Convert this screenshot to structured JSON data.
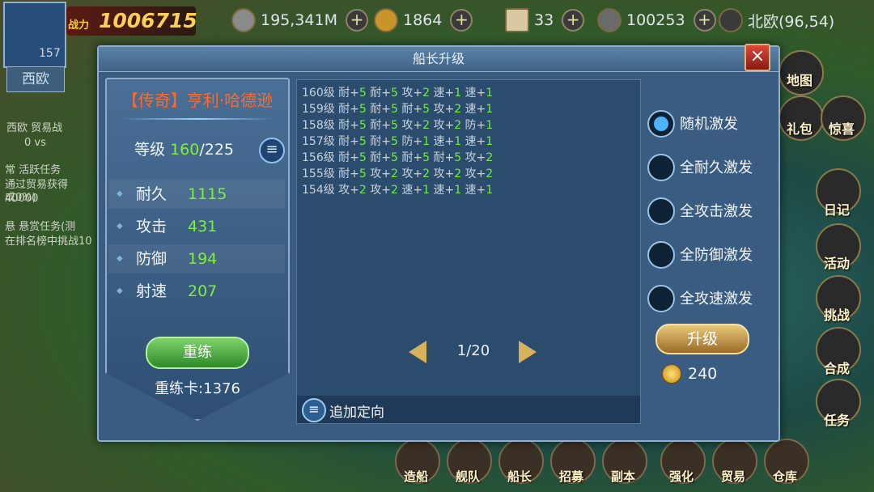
{
  "hud": {
    "power_label": "战力",
    "power_value": "1006715",
    "player_level": "157",
    "region": "西欧",
    "silver": "195,341M",
    "gold": "1864",
    "scroll_count": "33",
    "cannonballs": "100253",
    "location": "北欧(96,54)"
  },
  "left_hud": {
    "lines": [
      "西欧   贸易战",
      "0        vs",
      "常  活跃任务",
      "通过贸易获得40000",
      "成0%)",
      "悬  悬赏任务(测",
      "在排名榜中挑战10"
    ]
  },
  "right_menu": {
    "items": [
      "地图",
      "礼包",
      "惊喜",
      "日记",
      "活动",
      "挑战",
      "合成",
      "任务"
    ]
  },
  "bottom_menu": {
    "items": [
      "造船",
      "舰队",
      "船长",
      "招募",
      "副本",
      "强化",
      "贸易",
      "仓库"
    ]
  },
  "modal": {
    "title": "船长升级",
    "close_label": "×",
    "captain_name": "【传奇】亨利·哈德逊",
    "level_label": "等级",
    "level_current": "160",
    "level_max": "/225",
    "stats": [
      {
        "label": "耐久",
        "value": "1115"
      },
      {
        "label": "攻击",
        "value": "431"
      },
      {
        "label": "防御",
        "value": "194"
      },
      {
        "label": "射速",
        "value": "207"
      }
    ],
    "reset_button": "重练",
    "reset_cards": "重练卡:1376",
    "log": [
      {
        "level": "160级",
        "entries": [
          [
            "耐+",
            "5"
          ],
          [
            "耐+",
            "5"
          ],
          [
            "攻+",
            "2"
          ],
          [
            "速+",
            "1"
          ],
          [
            "速+",
            "1"
          ]
        ]
      },
      {
        "level": "159级",
        "entries": [
          [
            "耐+",
            "5"
          ],
          [
            "耐+",
            "5"
          ],
          [
            "耐+",
            "5"
          ],
          [
            "攻+",
            "2"
          ],
          [
            "速+",
            "1"
          ]
        ]
      },
      {
        "level": "158级",
        "entries": [
          [
            "耐+",
            "5"
          ],
          [
            "耐+",
            "5"
          ],
          [
            "攻+",
            "2"
          ],
          [
            "攻+",
            "2"
          ],
          [
            "防+",
            "1"
          ]
        ]
      },
      {
        "level": "157级",
        "entries": [
          [
            "耐+",
            "5"
          ],
          [
            "耐+",
            "5"
          ],
          [
            "防+",
            "1"
          ],
          [
            "速+",
            "1"
          ],
          [
            "速+",
            "1"
          ]
        ]
      },
      {
        "level": "156级",
        "entries": [
          [
            "耐+",
            "5"
          ],
          [
            "耐+",
            "5"
          ],
          [
            "耐+",
            "5"
          ],
          [
            "耐+",
            "5"
          ],
          [
            "攻+",
            "2"
          ]
        ]
      },
      {
        "level": "155级",
        "entries": [
          [
            "耐+",
            "5"
          ],
          [
            "攻+",
            "2"
          ],
          [
            "攻+",
            "2"
          ],
          [
            "攻+",
            "2"
          ],
          [
            "攻+",
            "2"
          ]
        ]
      },
      {
        "level": "154级",
        "entries": [
          [
            "攻+",
            "2"
          ],
          [
            "攻+",
            "2"
          ],
          [
            "速+",
            "1"
          ],
          [
            "速+",
            "1"
          ],
          [
            "速+",
            "1"
          ]
        ]
      }
    ],
    "page": "1/20",
    "append_label": "追加定向",
    "options": [
      {
        "label": "随机激发",
        "selected": true
      },
      {
        "label": "全耐久激发",
        "selected": false
      },
      {
        "label": "全攻击激发",
        "selected": false
      },
      {
        "label": "全防御激发",
        "selected": false
      },
      {
        "label": "全攻速激发",
        "selected": false
      }
    ],
    "upgrade_button": "升级",
    "cost": "240"
  }
}
